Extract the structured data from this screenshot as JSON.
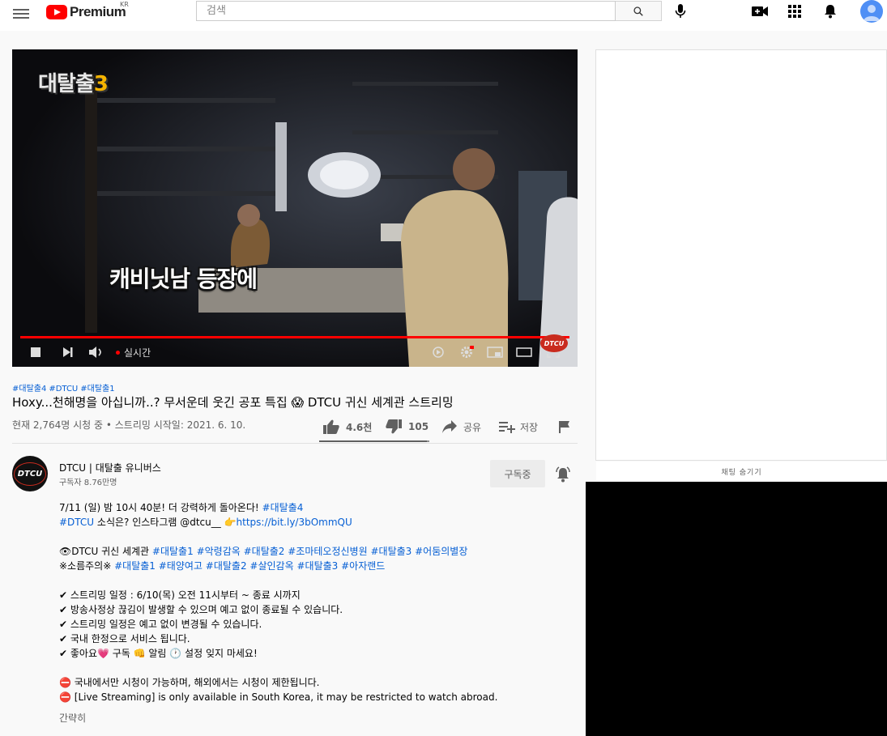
{
  "header": {
    "logo_text": "Premium",
    "country_code": "KR",
    "search_placeholder": "검색"
  },
  "player": {
    "show_logo_text": "대탈출",
    "show_logo_number": "3",
    "subtitle": "캐비닛남 등장에",
    "live_label": "실시간",
    "watermark": "DTCU",
    "progress_percent": 100
  },
  "video": {
    "tags": [
      "#대탈출4",
      "#DTCU",
      "#대탈출1"
    ],
    "title": "Hoxy...천해명을 아십니까..? 무서운데 웃긴 공포 특집 😱 DTCU 귀신 세계관 스트리밍",
    "meta": "현재 2,764명 시청 중 • 스트리밍 시작일: 2021. 6. 10.",
    "likes": "4.6천",
    "dislikes": "105",
    "share_label": "공유",
    "save_label": "저장",
    "like_ratio": 0.978
  },
  "channel": {
    "avatar_text": "DTCU",
    "name": "DTCU | 대탈출 유니버스",
    "subscribers": "구독자 8.76만명",
    "subscribe_label": "구독중"
  },
  "description": {
    "lines": [
      [
        {
          "t": "7/11 (일) 밤 10시 40분! 더 강력하게 돌아온다! "
        },
        {
          "t": "#대탈출4",
          "link": true
        }
      ],
      [
        {
          "t": "#DTCU",
          "link": true
        },
        {
          "t": " 소식은? 인스타그램 @dtcu__ 👉"
        },
        {
          "t": "https://bit.ly/3bOmmQU",
          "link": true
        }
      ],
      [],
      [
        {
          "t": "👁DTCU 귀신 세계관 "
        },
        {
          "t": "#대탈출1",
          "link": true
        },
        {
          "t": " "
        },
        {
          "t": "#악령감옥",
          "link": true
        },
        {
          "t": " "
        },
        {
          "t": "#대탈출2",
          "link": true
        },
        {
          "t": " "
        },
        {
          "t": "#조마테오정신병원",
          "link": true
        },
        {
          "t": " "
        },
        {
          "t": "#대탈출3",
          "link": true
        },
        {
          "t": " "
        },
        {
          "t": "#어둠의별장",
          "link": true
        }
      ],
      [
        {
          "t": "※소름주의※ "
        },
        {
          "t": "#대탈출1",
          "link": true
        },
        {
          "t": " "
        },
        {
          "t": "#태양여고",
          "link": true
        },
        {
          "t": " "
        },
        {
          "t": "#대탈출2",
          "link": true
        },
        {
          "t": " "
        },
        {
          "t": "#살인감옥",
          "link": true
        },
        {
          "t": " "
        },
        {
          "t": "#대탈출3",
          "link": true
        },
        {
          "t": " "
        },
        {
          "t": "#아자랜드",
          "link": true
        }
      ],
      [],
      [
        {
          "t": "✔ 스트리밍 일정 : 6/10(목) 오전 11시부터  ~ 종료 시까지"
        }
      ],
      [
        {
          "t": "✔ 방송사정상 끊김이 발생할 수 있으며 예고 없이 종료될 수 있습니다."
        }
      ],
      [
        {
          "t": "✔  스트리밍 일정은 예고 없이 변경될 수 있습니다."
        }
      ],
      [
        {
          "t": "✔ 국내 한정으로 서비스 됩니다."
        }
      ],
      [
        {
          "t": "✔ 좋아요💗 구독 👊 알림 🕐 설정 잊지 마세요!"
        }
      ],
      [],
      [
        {
          "t": "⛔ 국내에서만 시청이 가능하며, 해외에서는 시청이 제한됩니다."
        }
      ],
      [
        {
          "t": "⛔ [Live Streaming] is only available in South Korea, it may be restricted to watch abroad."
        }
      ]
    ],
    "show_less": "간략히"
  },
  "chat": {
    "hide_label": "채팅 숨기기"
  },
  "colors": {
    "brand_red": "#ff0000",
    "link_blue": "#065fd4"
  }
}
